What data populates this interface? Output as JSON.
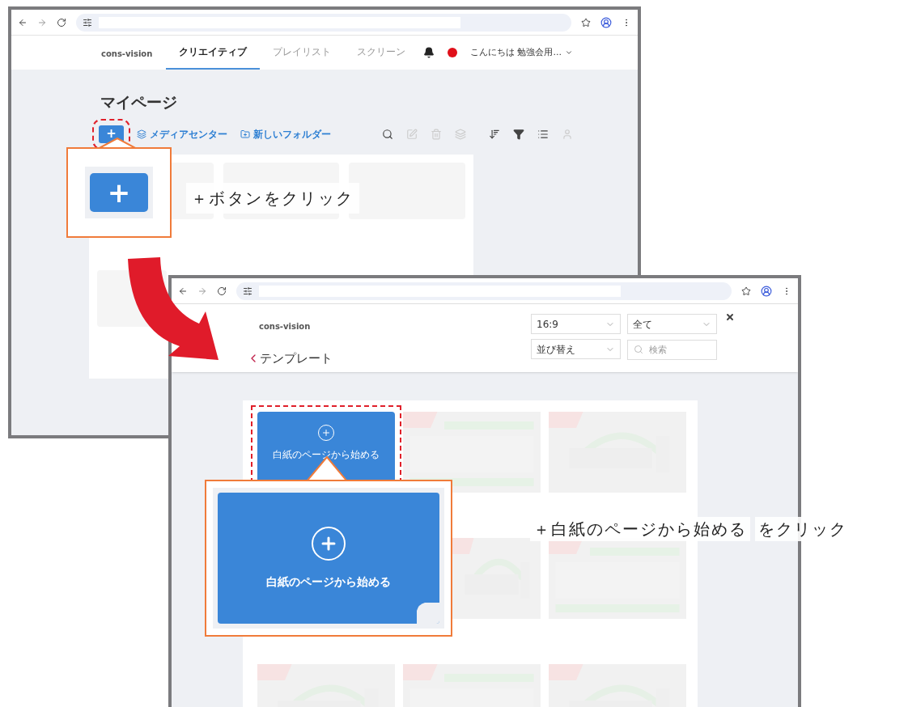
{
  "screenshot_1": {
    "nav": {
      "logo": "cons-vision",
      "tabs": [
        {
          "label": "クリエイティブ",
          "selected": true
        },
        {
          "label": "プレイリスト",
          "selected": false
        },
        {
          "label": "スクリーン",
          "selected": false
        }
      ],
      "greeting": "こんにちは 勉強会用..."
    },
    "page_title": "マイページ",
    "toolbar": {
      "add_button": "+",
      "links": [
        "メディアセンター",
        "新しいフォルダー"
      ]
    },
    "folders": [
      {
        "kind": "folder"
      },
      {
        "kind": "folder"
      },
      {
        "kind": "folder"
      },
      {
        "kind": "folder"
      }
    ]
  },
  "callout_1": {
    "button": "+",
    "caption": "＋ボタンをクリック"
  },
  "screenshot_2": {
    "logo": "cons-vision",
    "title": "テンプレート",
    "filters": [
      {
        "value": "16:9"
      },
      {
        "value": "全て"
      },
      {
        "value": "並び替え"
      }
    ],
    "search": {
      "placeholder": "検索"
    },
    "templates": [
      {
        "kind": "blank",
        "name": "白紙のページから始める"
      },
      {
        "kind": "template"
      },
      {
        "kind": "template"
      },
      {
        "kind": "hidden"
      },
      {
        "kind": "partial"
      },
      {
        "kind": "template"
      },
      {
        "kind": "template"
      },
      {
        "kind": "template"
      },
      {
        "kind": "template"
      }
    ]
  },
  "callout_2": {
    "card_label": "白紙のページから始める",
    "caption_main": "＋白紙のページから始める",
    "caption_tail": "をクリック"
  }
}
